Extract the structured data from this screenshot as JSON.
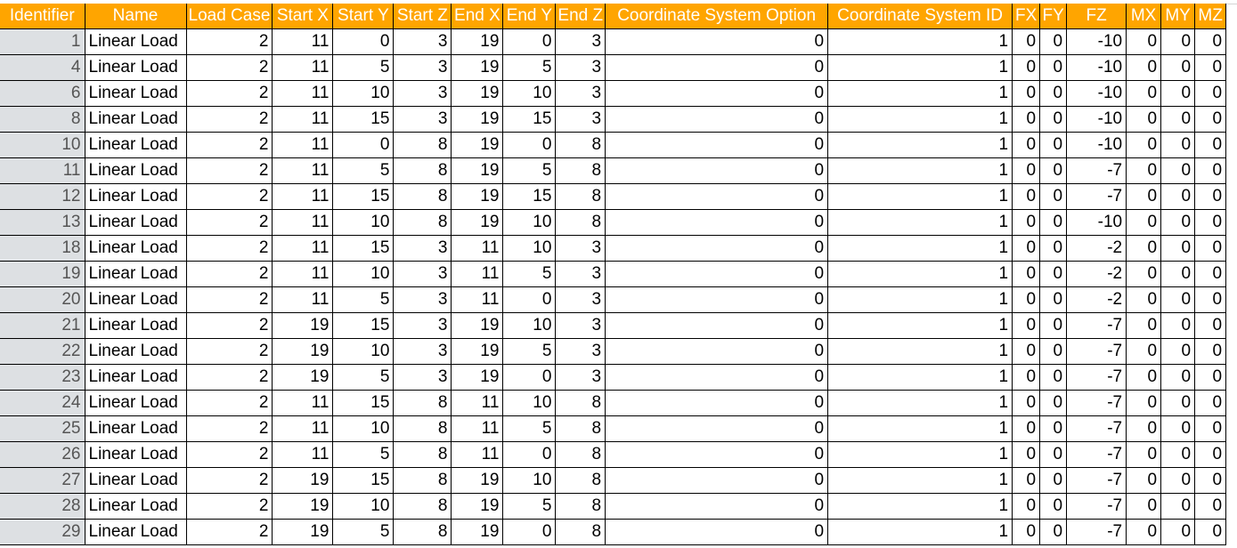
{
  "sheet": {
    "header_color": "#ffa500",
    "columns": [
      "Identifier",
      "Name",
      "Load Case",
      "Start X",
      "Start Y",
      "Start Z",
      "End X",
      "End Y",
      "End Z",
      "Coordinate System Option",
      "Coordinate System ID",
      "FX",
      "FY",
      "FZ",
      "MX",
      "MY",
      "MZ"
    ],
    "rows": [
      [
        "1",
        "Linear Load",
        "2",
        "11",
        "0",
        "3",
        "19",
        "0",
        "3",
        "0",
        "1",
        "0",
        "0",
        "-10",
        "0",
        "0",
        "0"
      ],
      [
        "4",
        "Linear Load",
        "2",
        "11",
        "5",
        "3",
        "19",
        "5",
        "3",
        "0",
        "1",
        "0",
        "0",
        "-10",
        "0",
        "0",
        "0"
      ],
      [
        "6",
        "Linear Load",
        "2",
        "11",
        "10",
        "3",
        "19",
        "10",
        "3",
        "0",
        "1",
        "0",
        "0",
        "-10",
        "0",
        "0",
        "0"
      ],
      [
        "8",
        "Linear Load",
        "2",
        "11",
        "15",
        "3",
        "19",
        "15",
        "3",
        "0",
        "1",
        "0",
        "0",
        "-10",
        "0",
        "0",
        "0"
      ],
      [
        "10",
        "Linear Load",
        "2",
        "11",
        "0",
        "8",
        "19",
        "0",
        "8",
        "0",
        "1",
        "0",
        "0",
        "-10",
        "0",
        "0",
        "0"
      ],
      [
        "11",
        "Linear Load",
        "2",
        "11",
        "5",
        "8",
        "19",
        "5",
        "8",
        "0",
        "1",
        "0",
        "0",
        "-7",
        "0",
        "0",
        "0"
      ],
      [
        "12",
        "Linear Load",
        "2",
        "11",
        "15",
        "8",
        "19",
        "15",
        "8",
        "0",
        "1",
        "0",
        "0",
        "-7",
        "0",
        "0",
        "0"
      ],
      [
        "13",
        "Linear Load",
        "2",
        "11",
        "10",
        "8",
        "19",
        "10",
        "8",
        "0",
        "1",
        "0",
        "0",
        "-10",
        "0",
        "0",
        "0"
      ],
      [
        "18",
        "Linear Load",
        "2",
        "11",
        "15",
        "3",
        "11",
        "10",
        "3",
        "0",
        "1",
        "0",
        "0",
        "-2",
        "0",
        "0",
        "0"
      ],
      [
        "19",
        "Linear Load",
        "2",
        "11",
        "10",
        "3",
        "11",
        "5",
        "3",
        "0",
        "1",
        "0",
        "0",
        "-2",
        "0",
        "0",
        "0"
      ],
      [
        "20",
        "Linear Load",
        "2",
        "11",
        "5",
        "3",
        "11",
        "0",
        "3",
        "0",
        "1",
        "0",
        "0",
        "-2",
        "0",
        "0",
        "0"
      ],
      [
        "21",
        "Linear Load",
        "2",
        "19",
        "15",
        "3",
        "19",
        "10",
        "3",
        "0",
        "1",
        "0",
        "0",
        "-7",
        "0",
        "0",
        "0"
      ],
      [
        "22",
        "Linear Load",
        "2",
        "19",
        "10",
        "3",
        "19",
        "5",
        "3",
        "0",
        "1",
        "0",
        "0",
        "-7",
        "0",
        "0",
        "0"
      ],
      [
        "23",
        "Linear Load",
        "2",
        "19",
        "5",
        "3",
        "19",
        "0",
        "3",
        "0",
        "1",
        "0",
        "0",
        "-7",
        "0",
        "0",
        "0"
      ],
      [
        "24",
        "Linear Load",
        "2",
        "11",
        "15",
        "8",
        "11",
        "10",
        "8",
        "0",
        "1",
        "0",
        "0",
        "-7",
        "0",
        "0",
        "0"
      ],
      [
        "25",
        "Linear Load",
        "2",
        "11",
        "10",
        "8",
        "11",
        "5",
        "8",
        "0",
        "1",
        "0",
        "0",
        "-7",
        "0",
        "0",
        "0"
      ],
      [
        "26",
        "Linear Load",
        "2",
        "11",
        "5",
        "8",
        "11",
        "0",
        "8",
        "0",
        "1",
        "0",
        "0",
        "-7",
        "0",
        "0",
        "0"
      ],
      [
        "27",
        "Linear Load",
        "2",
        "19",
        "15",
        "8",
        "19",
        "10",
        "8",
        "0",
        "1",
        "0",
        "0",
        "-7",
        "0",
        "0",
        "0"
      ],
      [
        "28",
        "Linear Load",
        "2",
        "19",
        "10",
        "8",
        "19",
        "5",
        "8",
        "0",
        "1",
        "0",
        "0",
        "-7",
        "0",
        "0",
        "0"
      ],
      [
        "29",
        "Linear Load",
        "2",
        "19",
        "5",
        "8",
        "19",
        "0",
        "8",
        "0",
        "1",
        "0",
        "0",
        "-7",
        "0",
        "0",
        "0"
      ]
    ]
  }
}
